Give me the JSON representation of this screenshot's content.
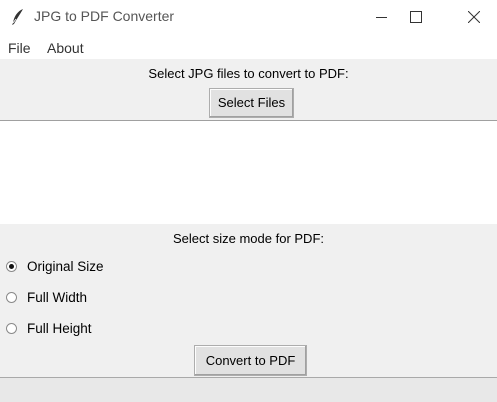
{
  "window": {
    "title": "JPG to PDF Converter",
    "icon": "feather-icon"
  },
  "menu": {
    "items": [
      {
        "label": "File"
      },
      {
        "label": "About"
      }
    ]
  },
  "select_section": {
    "label": "Select JPG files to convert to PDF:",
    "button_label": "Select Files"
  },
  "file_list": {
    "items": []
  },
  "size_section": {
    "label": "Select size mode for PDF:",
    "options": [
      {
        "label": "Original Size",
        "checked": true
      },
      {
        "label": "Full Width",
        "checked": false
      },
      {
        "label": "Full Height",
        "checked": false
      }
    ]
  },
  "convert": {
    "button_label": "Convert to PDF"
  },
  "status": {
    "text": ""
  }
}
